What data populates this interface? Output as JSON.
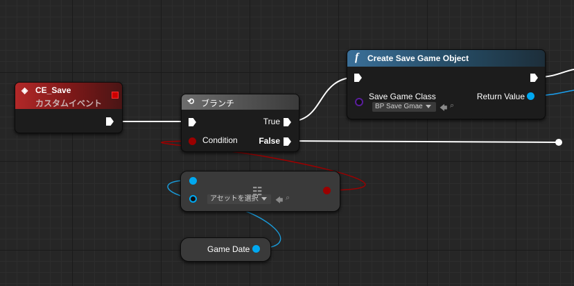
{
  "colors": {
    "exec": "#ffffff",
    "bool": "#8a0000",
    "object": "#00a8f0",
    "class": "#5a1e9c",
    "event_header": "#8e1d1d",
    "func_header": "#2b5b80"
  },
  "event_node": {
    "title": "CE_Save",
    "subtitle": "カスタムイベント"
  },
  "branch_node": {
    "title": "ブランチ",
    "icon": "branch-icon",
    "true_label": "True",
    "condition_label": "Condition",
    "false_label": "False"
  },
  "func_node": {
    "title": "Create Save Game Object",
    "icon": "function-f-icon",
    "class_label": "Save Game Class",
    "class_value": "BP Save Gmae",
    "return_label": "Return Value"
  },
  "cast_node": {
    "asset_value": "アセットを選択",
    "icon": "equals-icon"
  },
  "var_node": {
    "label": "Game Date"
  }
}
